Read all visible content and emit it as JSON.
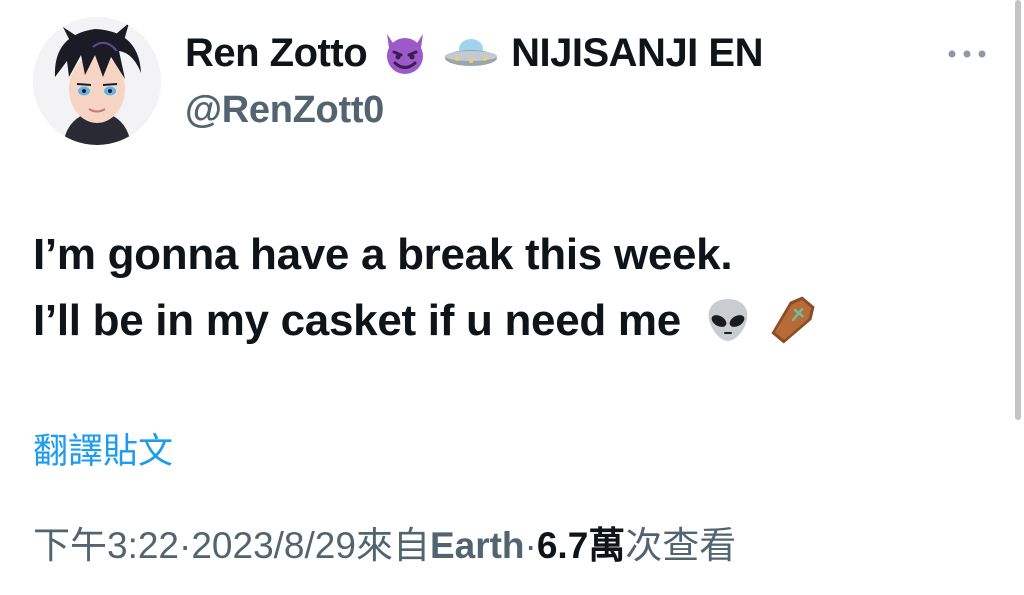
{
  "author": {
    "display_name": "Ren Zotto",
    "badge_emojis": [
      "smiling-devil-icon",
      "ufo-icon"
    ],
    "affiliation": "NIJISANJI EN",
    "handle": "@RenZott0"
  },
  "more_menu": {
    "icon": "more-dots-icon"
  },
  "tweet": {
    "line1": "I’m gonna have a break this week.",
    "line2": "I’ll be in my casket if u need me",
    "line2_emojis": [
      "alien-icon",
      "coffin-icon"
    ]
  },
  "translate": {
    "label": "翻譯貼文"
  },
  "meta": {
    "time": "下午3:22",
    "sep1": " · ",
    "date": "2023/8/29",
    "source_prefix": " 來自 ",
    "source": "Earth",
    "sep2": " · ",
    "views_count": "6.7萬",
    "views_label": " 次查看"
  },
  "colors": {
    "text": "#0f1419",
    "secondary": "#536471",
    "link": "#1d9bf0"
  }
}
